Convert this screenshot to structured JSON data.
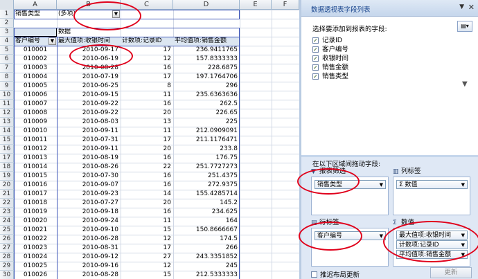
{
  "spreadsheet": {
    "columns": [
      "A",
      "B",
      "C",
      "D",
      "E",
      "F"
    ],
    "filter": {
      "label": "销售类型",
      "value": "(多项)"
    },
    "pivot": {
      "data_label": "数据",
      "headers": [
        "客户编号",
        "最大值项:收银时间",
        "计数项:记录ID",
        "平均值项:销售金额"
      ],
      "rows": [
        [
          "010001",
          "2010-09-17",
          "17",
          "236.9411765"
        ],
        [
          "010002",
          "2010-06-19",
          "12",
          "157.8333333"
        ],
        [
          "010003",
          "2010-08-28",
          "16",
          "228.6875"
        ],
        [
          "010004",
          "2010-07-19",
          "17",
          "197.1764706"
        ],
        [
          "010005",
          "2010-06-25",
          "8",
          "296"
        ],
        [
          "010006",
          "2010-09-15",
          "11",
          "235.6363636"
        ],
        [
          "010007",
          "2010-09-22",
          "16",
          "262.5"
        ],
        [
          "010008",
          "2010-09-22",
          "20",
          "226.65"
        ],
        [
          "010009",
          "2010-08-03",
          "13",
          "225"
        ],
        [
          "010010",
          "2010-09-11",
          "11",
          "212.0909091"
        ],
        [
          "010011",
          "2010-07-31",
          "17",
          "211.1176471"
        ],
        [
          "010012",
          "2010-09-11",
          "20",
          "233.8"
        ],
        [
          "010013",
          "2010-08-19",
          "16",
          "176.75"
        ],
        [
          "010014",
          "2010-08-26",
          "22",
          "251.7727273"
        ],
        [
          "010015",
          "2010-07-30",
          "16",
          "251.4375"
        ],
        [
          "010016",
          "2010-09-07",
          "16",
          "272.9375"
        ],
        [
          "010017",
          "2010-09-23",
          "14",
          "155.4285714"
        ],
        [
          "010018",
          "2010-07-27",
          "20",
          "145.2"
        ],
        [
          "010019",
          "2010-09-18",
          "16",
          "234.625"
        ],
        [
          "010020",
          "2010-09-24",
          "11",
          "164"
        ],
        [
          "010021",
          "2010-09-10",
          "15",
          "150.8666667"
        ],
        [
          "010022",
          "2010-06-28",
          "12",
          "174.5"
        ],
        [
          "010023",
          "2010-08-31",
          "17",
          "266"
        ],
        [
          "010024",
          "2010-09-12",
          "27",
          "243.3351852"
        ],
        [
          "010025",
          "2010-09-16",
          "12",
          "245"
        ],
        [
          "010026",
          "2010-08-28",
          "15",
          "212.5333333"
        ]
      ]
    }
  },
  "pane": {
    "title": "数据透视表字段列表",
    "close_glyph": "✕",
    "dropdown_glyph": "▼",
    "layout_glyph": "▤▾",
    "prompt": "选择要添加到报表的字段:",
    "fields": [
      "记录ID",
      "客户编号",
      "收银时间",
      "销售金额",
      "销售类型"
    ],
    "filter_glyph": "▼",
    "drag_prompt": "在以下区域间拖动字段:",
    "areas": {
      "report_filter": {
        "label": "报表筛选",
        "items": [
          "销售类型"
        ]
      },
      "column_labels": {
        "label": "列标签",
        "items": [
          "Σ 数值"
        ]
      },
      "row_labels": {
        "label": "行标签",
        "items": [
          "客户编号"
        ]
      },
      "values": {
        "label": "数值",
        "items": [
          "最大值项:收银时间",
          "计数项:记录ID",
          "平均值项:销售金额"
        ]
      }
    },
    "defer_label": "推迟布局更新",
    "update_label": "更新"
  },
  "colors": {
    "pivot_border": "#3e56b8",
    "annotation": "#e0001b",
    "pane_bg": "#dfe8f5",
    "header_fill": "#dce6f1"
  }
}
